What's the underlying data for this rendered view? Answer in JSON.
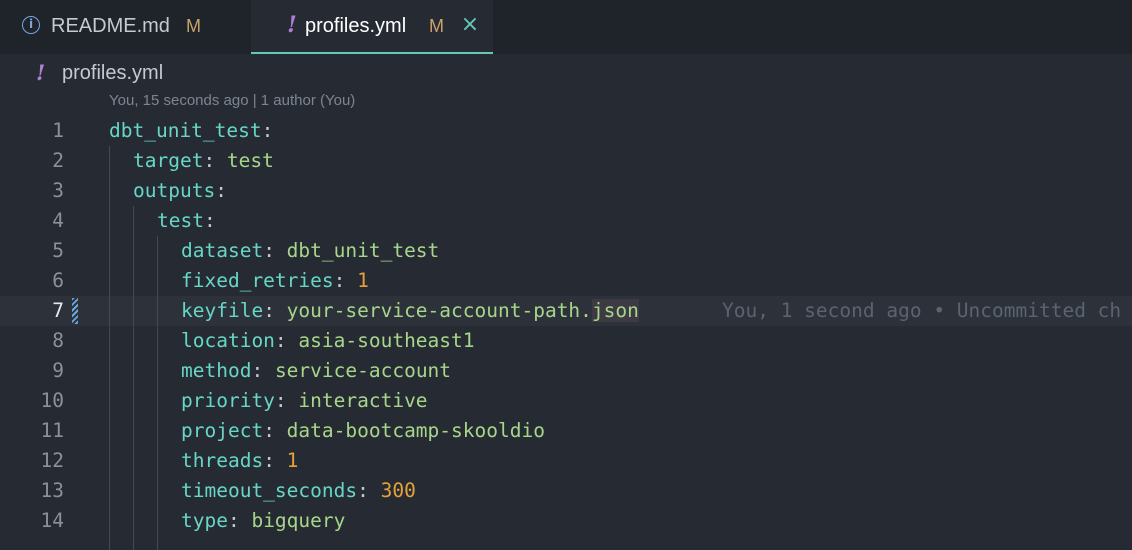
{
  "tabs": [
    {
      "icon": "info-icon",
      "label": "README.md",
      "badge": "M",
      "active": false
    },
    {
      "icon": "yaml-exclamation-icon",
      "label": "profiles.yml",
      "badge": "M",
      "active": true,
      "close": "×"
    }
  ],
  "breadcrumb": {
    "icon": "!",
    "label": "profiles.yml"
  },
  "blame_header": "You, 15 seconds ago | 1 author (You)",
  "lines": [
    {
      "n": "1",
      "key": "dbt_unit_test",
      "sep": ":",
      "val": "",
      "type": ""
    },
    {
      "n": "2",
      "key": "target",
      "sep": ": ",
      "val": "test",
      "type": "str"
    },
    {
      "n": "3",
      "key": "outputs",
      "sep": ":",
      "val": "",
      "type": ""
    },
    {
      "n": "4",
      "key": "test",
      "sep": ":",
      "val": "",
      "type": ""
    },
    {
      "n": "5",
      "key": "dataset",
      "sep": ": ",
      "val": "dbt_unit_test",
      "type": "str"
    },
    {
      "n": "6",
      "key": "fixed_retries",
      "sep": ": ",
      "val": "1",
      "type": "num"
    },
    {
      "n": "7",
      "key": "keyfile",
      "sep": ": ",
      "val": "your-service-account-path.json",
      "type": "str"
    },
    {
      "n": "8",
      "key": "location",
      "sep": ": ",
      "val": "asia-southeast1",
      "type": "str"
    },
    {
      "n": "9",
      "key": "method",
      "sep": ": ",
      "val": "service-account",
      "type": "str"
    },
    {
      "n": "10",
      "key": "priority",
      "sep": ": ",
      "val": "interactive",
      "type": "str"
    },
    {
      "n": "11",
      "key": "project",
      "sep": ": ",
      "val": "data-bootcamp-skooldio",
      "type": "str"
    },
    {
      "n": "12",
      "key": "threads",
      "sep": ": ",
      "val": "1",
      "type": "num"
    },
    {
      "n": "13",
      "key": "timeout_seconds",
      "sep": ": ",
      "val": "300",
      "type": "num"
    },
    {
      "n": "14",
      "key": "type",
      "sep": ": ",
      "val": "bigquery",
      "type": "str"
    }
  ],
  "inline_blame": "You, 1 second ago • Uncommitted ch",
  "current_line": "7",
  "colors": {
    "key": "#67d6c7",
    "string": "#a7d68a",
    "number": "#e6a13b",
    "accent": "#67c8b9",
    "yaml_icon": "#b07fd6",
    "modified_badge": "#c9a26b"
  }
}
